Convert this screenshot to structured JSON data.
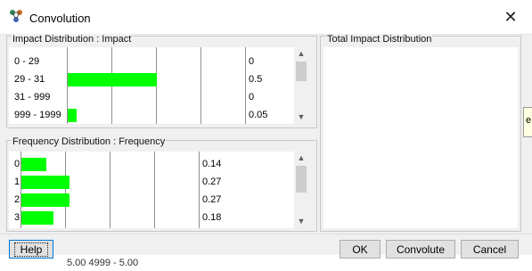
{
  "window": {
    "title": "Convolution",
    "close_glyph": "✕",
    "icon": "app-icon"
  },
  "background": {
    "behind_bottom": "5.00 4999 - 5.00",
    "behind_right": "e"
  },
  "impact": {
    "label": "Impact Distribution : Impact",
    "rows": [
      {
        "category": "0 - 29",
        "value": "0",
        "level": 0
      },
      {
        "category": "29 - 31",
        "value": "0.5",
        "level": 0.5
      },
      {
        "category": "31 - 999",
        "value": "0",
        "level": 0
      },
      {
        "category": "999 - 1999",
        "value": "0.05",
        "level": 0.05
      }
    ]
  },
  "frequency": {
    "label": "Frequency Distribution : Frequency",
    "rows": [
      {
        "category": "0",
        "value": "0.14",
        "level": 0.14
      },
      {
        "category": "1",
        "value": "0.27",
        "level": 0.27
      },
      {
        "category": "2",
        "value": "0.27",
        "level": 0.27
      },
      {
        "category": "3",
        "value": "0.18",
        "level": 0.18
      }
    ]
  },
  "total": {
    "label": "Total Impact Distribution"
  },
  "buttons": {
    "help": "Help",
    "ok": "OK",
    "convolute": "Convolute",
    "cancel": "Cancel"
  },
  "colors": {
    "bar": "#00ff00",
    "accent": "#0078d7"
  }
}
